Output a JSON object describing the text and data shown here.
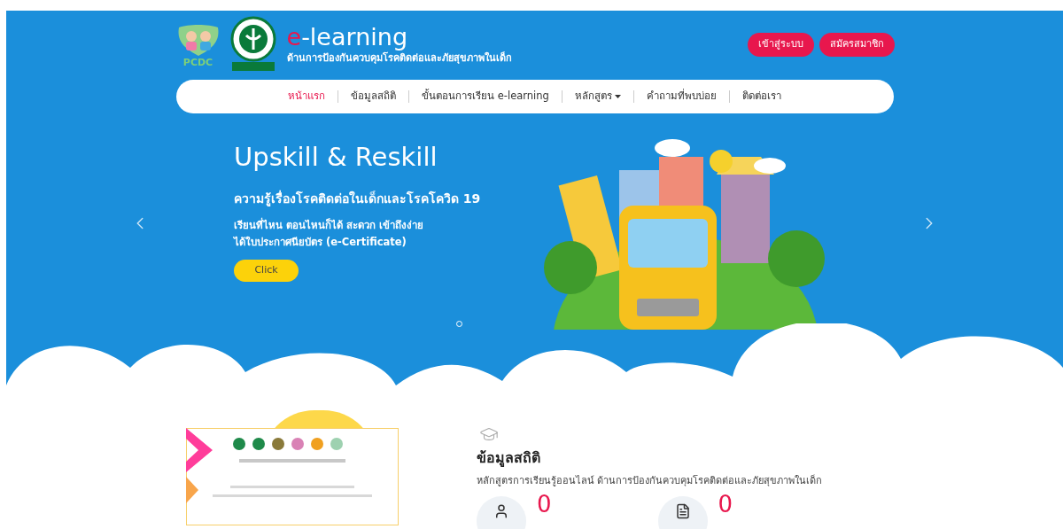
{
  "header": {
    "title_prefix": "e",
    "title_rest": "-learning",
    "subtitle": "ด้านการป้องกันควบคุมโรคติดต่อและภัยสุขภาพในเด็ก",
    "logo_text": "PCDC",
    "buttons": [
      "เข้าสู่ระบบ",
      "สมัครสมาชิก"
    ]
  },
  "nav": [
    {
      "label": "หน้าแรก",
      "selected": true,
      "dropdown": false
    },
    {
      "label": "ข้อมูลสถิติ",
      "selected": false,
      "dropdown": false
    },
    {
      "label": "ขั้นตอนการเรียน e-learning",
      "selected": false,
      "dropdown": false
    },
    {
      "label": "หลักสูตร",
      "selected": false,
      "dropdown": true
    },
    {
      "label": "คำถามที่พบบ่อย",
      "selected": false,
      "dropdown": false
    },
    {
      "label": "ติดต่อเรา",
      "selected": false,
      "dropdown": false
    }
  ],
  "hero": {
    "title": "Upskill & Reskill",
    "subtitle": "ความรู้เรื่องโรคติดต่อในเด็กและโรคโควิด 19",
    "lines": [
      "เรียนที่ไหน ตอนไหนก็ได้ สะดวก เข้าถึงง่าย",
      "ได้ใบประกาศนียบัตร (e-Certificate)"
    ],
    "button": "Click",
    "slides": [
      {
        "selected": true
      }
    ]
  },
  "stats": {
    "heading": "ข้อมูลสถิติ",
    "description": "หลักสูตรการเรียนรู้ออนไลน์ ด้านการป้องกันควบคุมโรคติดต่อและภัยสุขภาพในเด็ก",
    "items": [
      {
        "kind": "person",
        "value": "0"
      },
      {
        "kind": "document",
        "value": "0"
      }
    ]
  }
}
